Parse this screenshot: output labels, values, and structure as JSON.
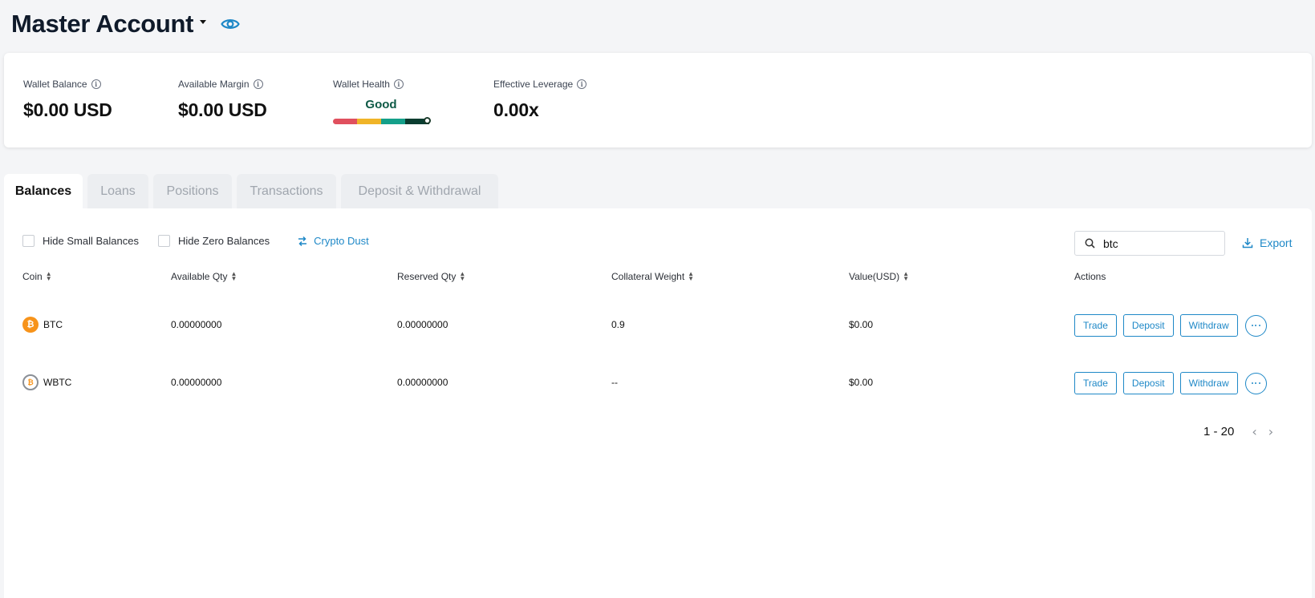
{
  "header": {
    "title": "Master Account",
    "dropdown_icon": "caret-down-icon",
    "visibility_icon": "eye-icon"
  },
  "summary": {
    "wallet_balance": {
      "label": "Wallet Balance",
      "value": "$0.00 USD"
    },
    "available_margin": {
      "label": "Available Margin",
      "value": "$0.00 USD"
    },
    "wallet_health": {
      "label": "Wallet Health",
      "value": "Good",
      "bar_colors": [
        "#e0505e",
        "#f0b428",
        "#14a08a",
        "#0a3d30"
      ]
    },
    "effective_leverage": {
      "label": "Effective Leverage",
      "value": "0.00x"
    }
  },
  "tabs": [
    {
      "label": "Balances",
      "active": true
    },
    {
      "label": "Loans",
      "active": false
    },
    {
      "label": "Positions",
      "active": false
    },
    {
      "label": "Transactions",
      "active": false
    },
    {
      "label": "Deposit & Withdrawal",
      "active": false
    }
  ],
  "toolbar": {
    "hide_small": "Hide Small Balances",
    "hide_zero": "Hide Zero Balances",
    "crypto_dust": "Crypto Dust",
    "search_value": "btc",
    "export": "Export"
  },
  "table": {
    "columns": [
      "Coin",
      "Available Qty",
      "Reserved Qty",
      "Collateral Weight",
      "Value(USD)",
      "Actions"
    ],
    "rows": [
      {
        "coin": "BTC",
        "available": "0.00000000",
        "reserved": "0.00000000",
        "weight": "0.9",
        "value": "$0.00"
      },
      {
        "coin": "WBTC",
        "available": "0.00000000",
        "reserved": "0.00000000",
        "weight": "--",
        "value": "$0.00"
      }
    ],
    "actions": {
      "trade": "Trade",
      "deposit": "Deposit",
      "withdraw": "Withdraw"
    }
  },
  "pagination": {
    "range": "1 - 20"
  },
  "colors": {
    "accent": "#1e88c7",
    "btc": "#f7931a",
    "health_text": "#0e5a46"
  }
}
